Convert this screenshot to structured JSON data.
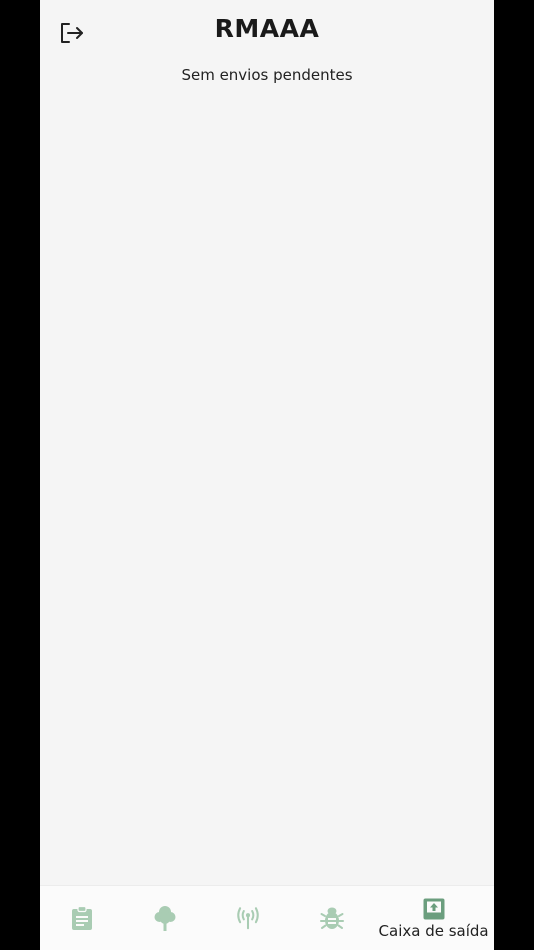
{
  "header": {
    "title": "RMAAA",
    "logout_icon": "logout-icon"
  },
  "main": {
    "empty_message": "Sem envios pendentes"
  },
  "tabbar": {
    "active_color": "#6b9e7e",
    "inactive_color": "#a9ccb3",
    "items": [
      {
        "icon": "clipboard-icon",
        "label": ""
      },
      {
        "icon": "tree-icon",
        "label": ""
      },
      {
        "icon": "antenna-icon",
        "label": ""
      },
      {
        "icon": "bug-icon",
        "label": ""
      },
      {
        "icon": "outbox-icon",
        "label": "Caixa de saída",
        "active": true
      }
    ]
  }
}
